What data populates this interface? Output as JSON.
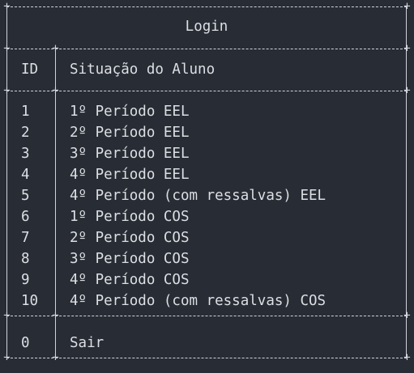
{
  "menu": {
    "title": "Login",
    "header": {
      "id": "ID",
      "label": "Situação do Aluno"
    },
    "options": [
      {
        "id": "1",
        "label": "1º Período EEL"
      },
      {
        "id": "2",
        "label": "2º Período EEL"
      },
      {
        "id": "3",
        "label": "3º Período EEL"
      },
      {
        "id": "4",
        "label": "4º Período EEL"
      },
      {
        "id": "5",
        "label": "4º Período (com ressalvas) EEL"
      },
      {
        "id": "6",
        "label": "1º Período COS"
      },
      {
        "id": "7",
        "label": "2º Período COS"
      },
      {
        "id": "8",
        "label": "3º Período COS"
      },
      {
        "id": "9",
        "label": "4º Período COS"
      },
      {
        "id": "10",
        "label": "4º Período (com ressalvas) COS"
      }
    ],
    "exit": {
      "id": "0",
      "label": "Sair"
    }
  }
}
